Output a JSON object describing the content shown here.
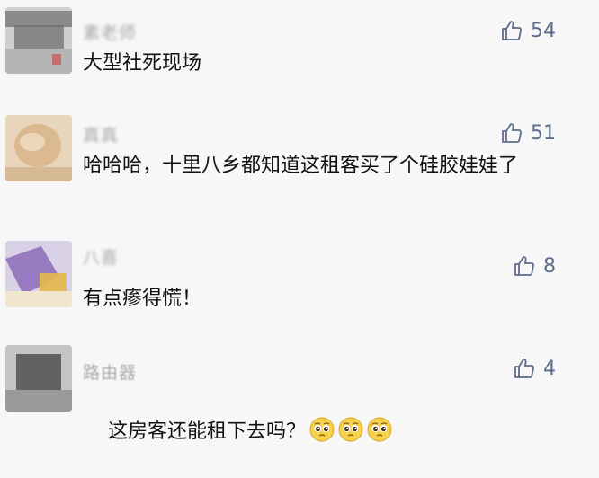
{
  "comments": [
    {
      "username": "素老师",
      "likes": "54",
      "text": "大型社死现场",
      "avatar_colors": [
        "#6a6a6a",
        "#c8c8c8"
      ]
    },
    {
      "username": "真真",
      "likes": "51",
      "text": "哈哈哈，十里八乡都知道这租客买了个硅胶娃娃了",
      "avatar_colors": [
        "#e0c39a",
        "#caa07a"
      ]
    },
    {
      "username": "八喜",
      "likes": "8",
      "text": "有点瘆得慌！",
      "avatar_colors": [
        "#8b6bb8",
        "#e6b84a"
      ]
    },
    {
      "username": "路由器",
      "likes": "4",
      "text": "这房客还能租下去吗？",
      "emoji_count": 3,
      "avatar_colors": [
        "#4a4a4a",
        "#bdbdbd"
      ]
    }
  ],
  "icons": {
    "like": "thumbs-up-outline-icon",
    "emoji": "pleading-face-emoji"
  },
  "colors": {
    "like_count": "#5d6d8c",
    "text": "#111111",
    "username": "#a9a9a9",
    "background": "#f7f7f7"
  }
}
